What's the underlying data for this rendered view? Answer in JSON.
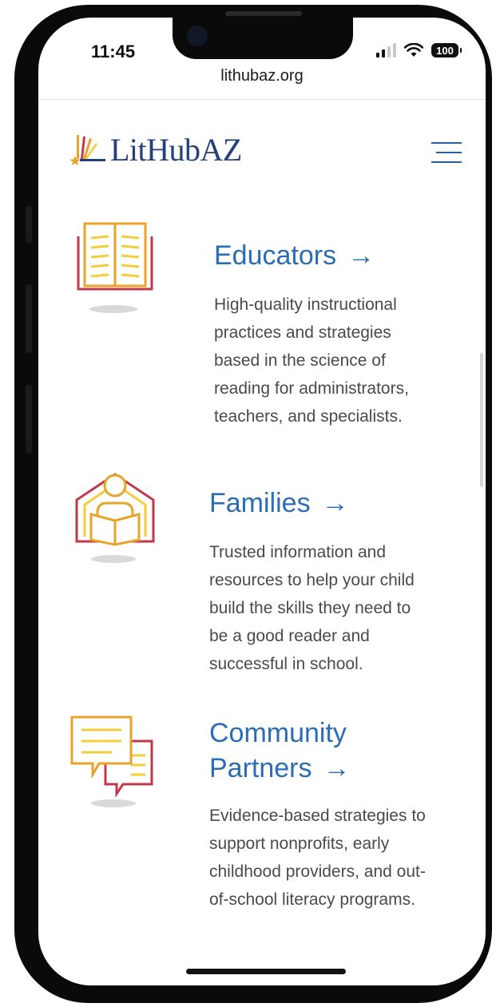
{
  "status_bar": {
    "time": "11:45",
    "battery": "100"
  },
  "browser": {
    "url": "lithubaz.org"
  },
  "header": {
    "logo_text": "LitHubAZ",
    "menu_icon": "hamburger-menu-icon"
  },
  "sections": [
    {
      "title": "Educators",
      "arrow": "→",
      "icon": "open-book-icon",
      "description_lines": [
        "High-quality instructional",
        "practices and strategies",
        "based in the science of",
        "reading for administrators,",
        "teachers, and specialists."
      ]
    },
    {
      "title": "Families",
      "arrow": "→",
      "icon": "child-reading-home-icon",
      "description_lines": [
        "Trusted information and",
        "resources to help your child",
        "build the skills they need to",
        "be a good reader and",
        "successful in school."
      ]
    },
    {
      "title_lines": [
        "Community",
        "Partners"
      ],
      "arrow": "→",
      "icon": "speech-bubbles-icon",
      "description_lines": [
        "Evidence-based strategies to",
        "support nonprofits, early",
        "childhood providers, and out-",
        "of-school literacy programs."
      ]
    }
  ],
  "colors": {
    "link_blue": "#2a6db5",
    "logo_navy": "#23407a",
    "icon_gold": "#e8a32b",
    "icon_yellow": "#f4cd3d",
    "icon_red": "#c0394b"
  }
}
